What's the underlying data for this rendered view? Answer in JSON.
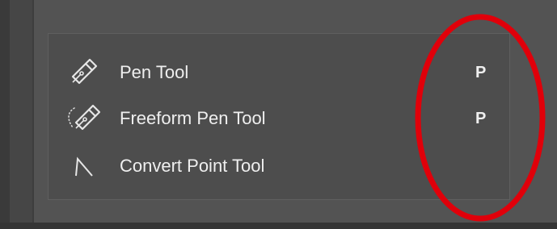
{
  "menu": {
    "items": [
      {
        "icon": "pen-icon",
        "label": "Pen Tool",
        "shortcut": "P"
      },
      {
        "icon": "freeform-pen-icon",
        "label": "Freeform Pen Tool",
        "shortcut": "P"
      },
      {
        "icon": "convert-point-icon",
        "label": "Convert Point Tool",
        "shortcut": ""
      }
    ]
  },
  "colors": {
    "panel_background": "#535353",
    "flyout_background": "#4d4d4d",
    "text": "#efefef",
    "highlight_circle": "#e0000a"
  }
}
